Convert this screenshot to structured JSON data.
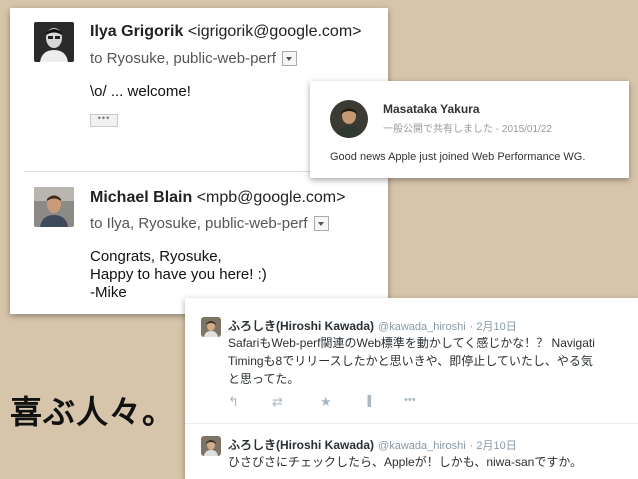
{
  "emails": [
    {
      "sender_name": "Ilya Grigorik",
      "sender_email": "<igrigorik@google.com>",
      "recipients": "to Ryosuke, public-web-perf",
      "body_lines": [
        "\\o/ ... welcome!"
      ],
      "collapsed_label": "•••"
    },
    {
      "sender_name": "Michael Blain",
      "sender_email": "<mpb@google.com>",
      "recipients": "to Ilya, Ryosuke, public-web-perf",
      "body_lines": [
        "Congrats, Ryosuke,",
        "Happy to have you here! :)",
        "-Mike"
      ]
    }
  ],
  "gplus_post": {
    "author": "Masataka Yakura",
    "meta": "一般公開で共有しました  -  2015/01/22",
    "text": "Good news Apple just joined Web Performance WG."
  },
  "tweets": [
    {
      "name": "ふろしき(Hiroshi Kawada)",
      "handle": "@kawada_hiroshi",
      "date": "· 2月10日",
      "lines": [
        "SafariもWeb-perf関連のWeb標準を動かしてく感じかな！？ Navigati",
        "Timingも8でリリースしたかと思いきや、即停止していたし、やる気",
        "と思ってた。"
      ]
    },
    {
      "name": "ふろしき(Hiroshi Kawada)",
      "handle": "@kawada_hiroshi",
      "date": "· 2月10日",
      "lines": [
        "ひさびさにチェックしたら、Appleが！しかも、niwa-sanですか。"
      ]
    }
  ],
  "tweet_actions": {
    "reply_icon": "↰",
    "retweet_icon": "⇄",
    "favorite_icon": "★",
    "stats_icon": "▐",
    "more_icon": "•••"
  },
  "caption": "喜ぶ人々。"
}
